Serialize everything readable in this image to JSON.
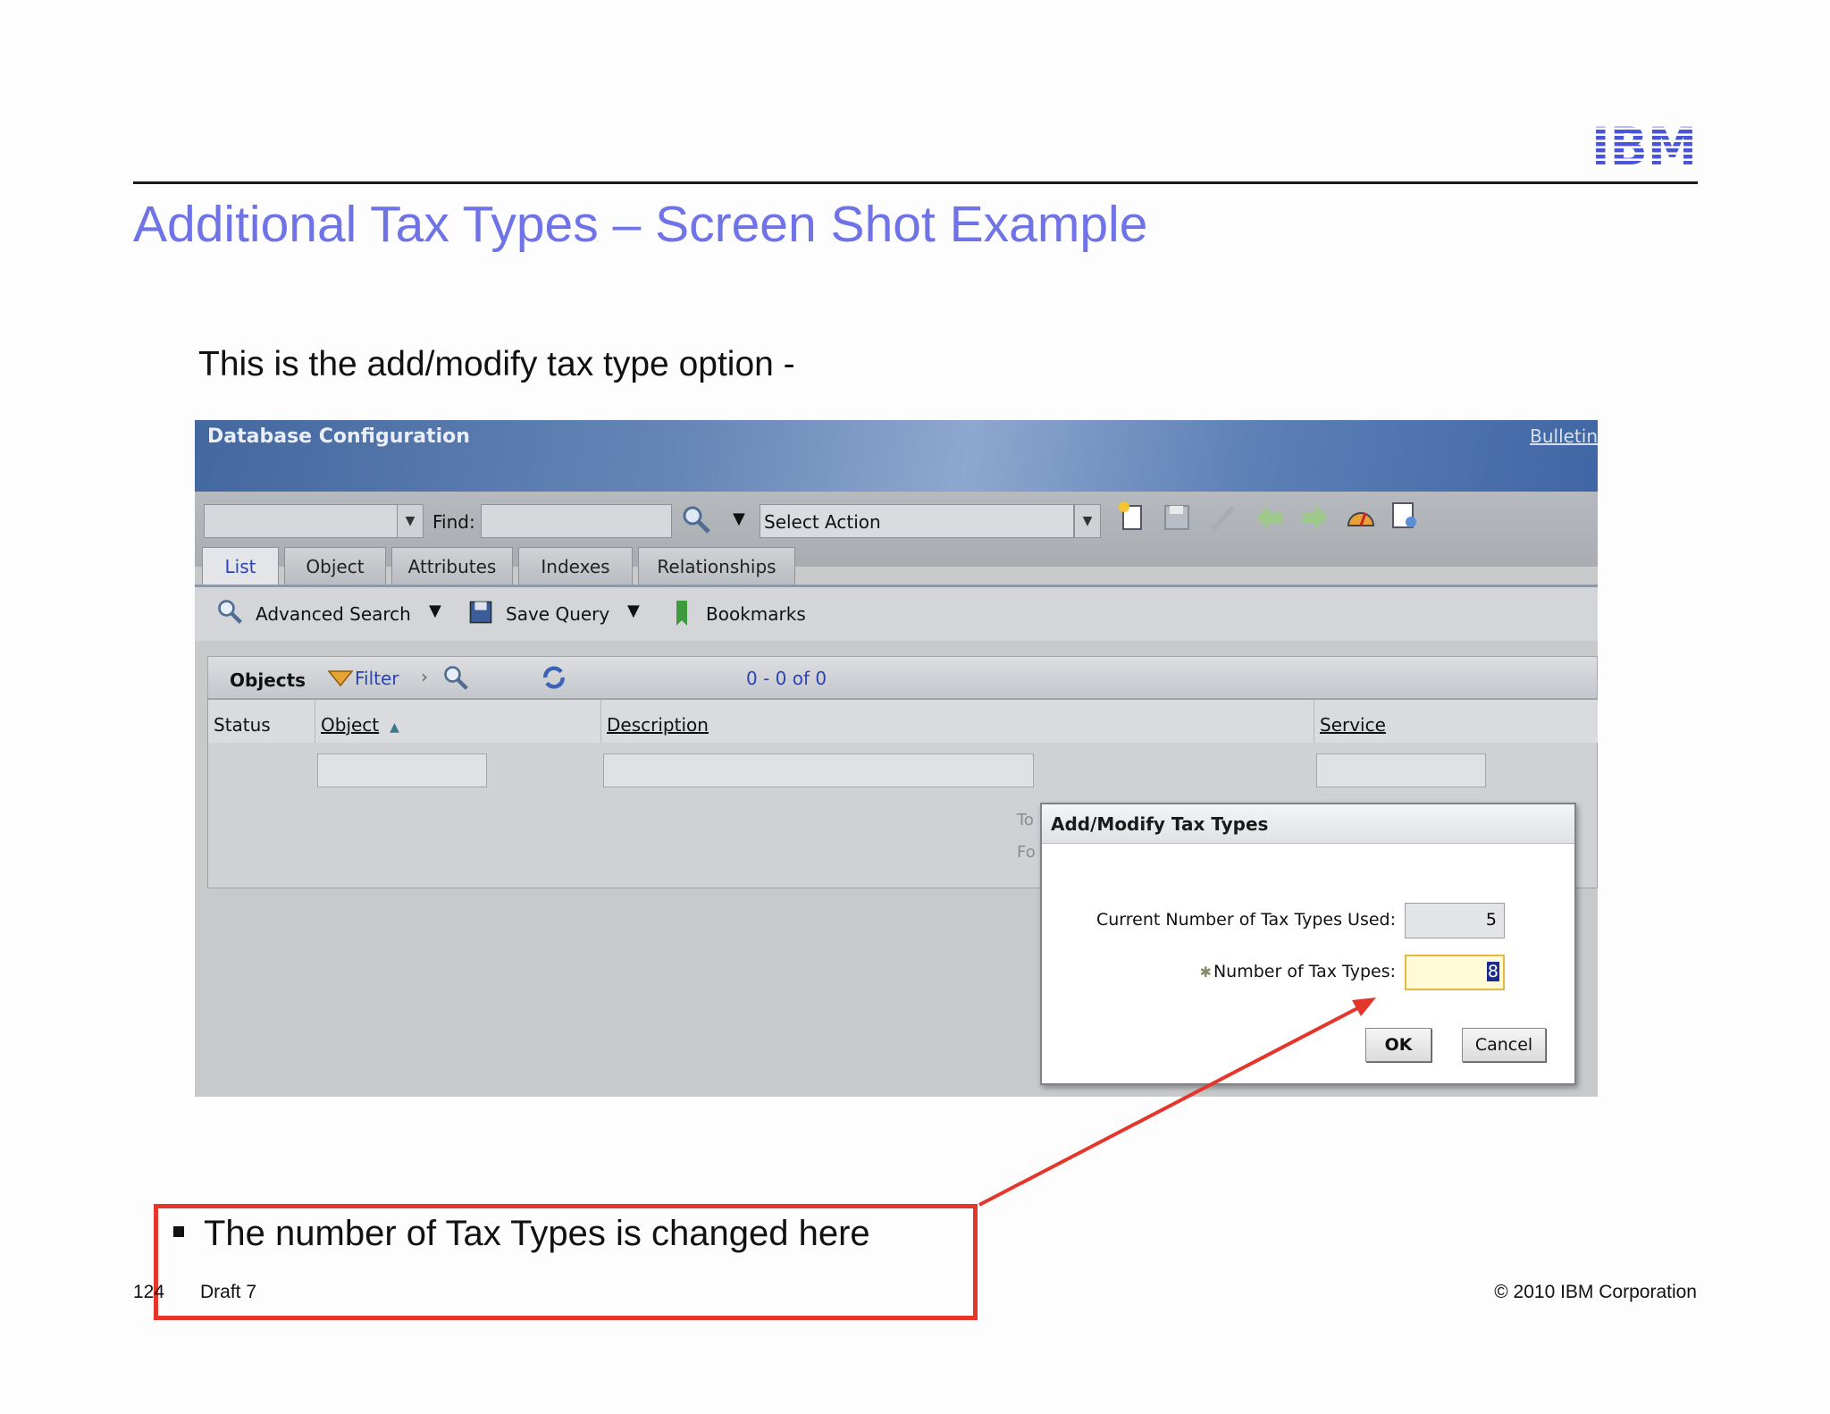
{
  "slide": {
    "title": "Additional Tax Types – Screen Shot Example",
    "intro": "This is the add/modify tax type option -",
    "logo_text": "IBM",
    "callout": "The number of Tax Types is changed here",
    "footer_page": "124",
    "footer_draft": "Draft 7",
    "footer_copyright": "© 2010 IBM Corporation",
    "colors": {
      "title": "#6f73e6",
      "callout_border": "#e4362b",
      "logo": "#4955d6"
    }
  },
  "app": {
    "window_title": "Database Configuration",
    "bulletin": "Bulletin",
    "toolbar": {
      "find_label": "Find:",
      "select_action": "Select Action",
      "icons": [
        "search-icon",
        "new-record-icon",
        "save-icon",
        "clear-icon",
        "previous-arrow-icon",
        "next-arrow-icon",
        "gauge-icon",
        "report-icon"
      ]
    },
    "tabs": [
      "List",
      "Object",
      "Attributes",
      "Indexes",
      "Relationships"
    ],
    "active_tab": "List",
    "subbar": {
      "advanced_search": "Advanced Search",
      "save_query": "Save Query",
      "bookmarks": "Bookmarks"
    },
    "objects_bar": {
      "label": "Objects",
      "filter": "Filter",
      "range": "0 - 0 of 0"
    },
    "columns": [
      "Status",
      "Object",
      "Description",
      "Service"
    ],
    "partial_text": [
      "To",
      "Fo"
    ],
    "dialog": {
      "title": "Add/Modify Tax Types",
      "current_label": "Current Number of Tax Types Used:",
      "current_value": "5",
      "number_label": "Number of Tax Types:",
      "number_value": "8",
      "ok": "OK",
      "cancel": "Cancel"
    }
  }
}
